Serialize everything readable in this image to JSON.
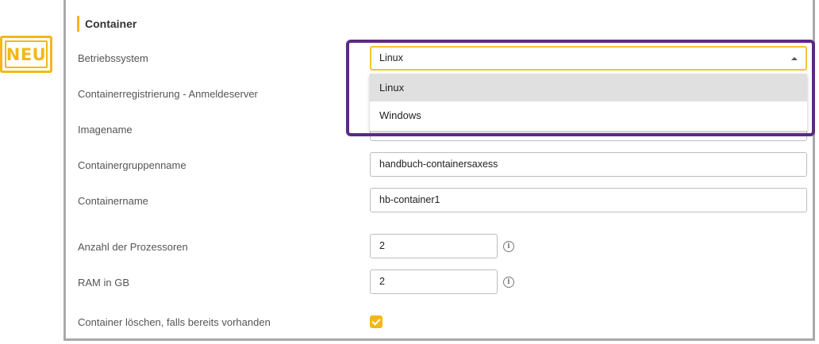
{
  "badge": {
    "text": "NEU"
  },
  "section": {
    "title": "Container"
  },
  "fields": {
    "os": {
      "label": "Betriebssystem",
      "value": "Linux",
      "options": [
        "Linux",
        "Windows"
      ]
    },
    "registry_server": {
      "label": "Containerregistrierung - Anmeldeserver"
    },
    "image_name": {
      "label": "Imagename"
    },
    "group_name": {
      "label": "Containergruppenname",
      "value": "handbuch-containersaxess"
    },
    "container_name": {
      "label": "Containername",
      "value": "hb-container1"
    },
    "cpu_count": {
      "label": "Anzahl der Prozessoren",
      "value": "2"
    },
    "ram": {
      "label": "RAM in GB",
      "value": "2"
    },
    "delete_existing": {
      "label": "Container löschen, falls bereits vorhanden",
      "checked": true
    }
  },
  "colors": {
    "accent": "#f3b71b",
    "highlight": "#5c2a82"
  }
}
